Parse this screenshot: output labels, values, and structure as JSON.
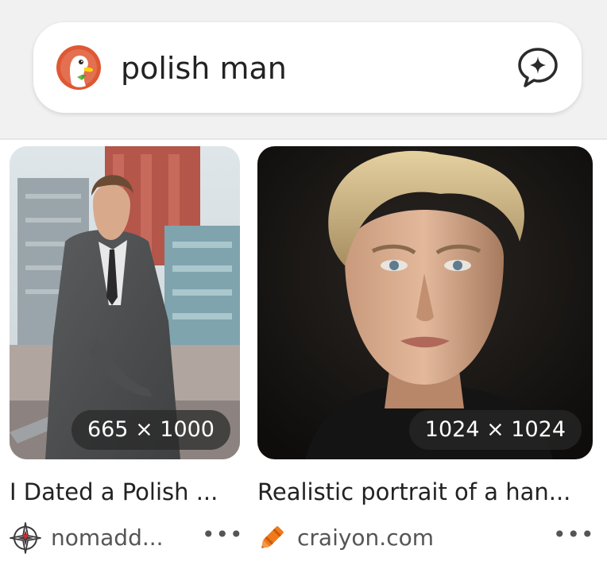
{
  "search": {
    "query": "polish man",
    "logo_icon": "duckduckgo-logo",
    "assist_icon": "ai-chat-icon"
  },
  "results": [
    {
      "dimensions": "665 × 1000",
      "title": "I Dated a Polish ...",
      "source": "nomadd...",
      "source_icon": "compass-rose-icon",
      "more_label": "•••"
    },
    {
      "dimensions": "1024 × 1024",
      "title": "Realistic portrait of a han...",
      "source": "craiyon.com",
      "source_icon": "crayon-icon",
      "more_label": "•••"
    }
  ],
  "colors": {
    "background": "#ffffff",
    "header_background": "#f1f1f1",
    "ddg_orange": "#de5833",
    "crayon_orange": "#f07a1b"
  }
}
